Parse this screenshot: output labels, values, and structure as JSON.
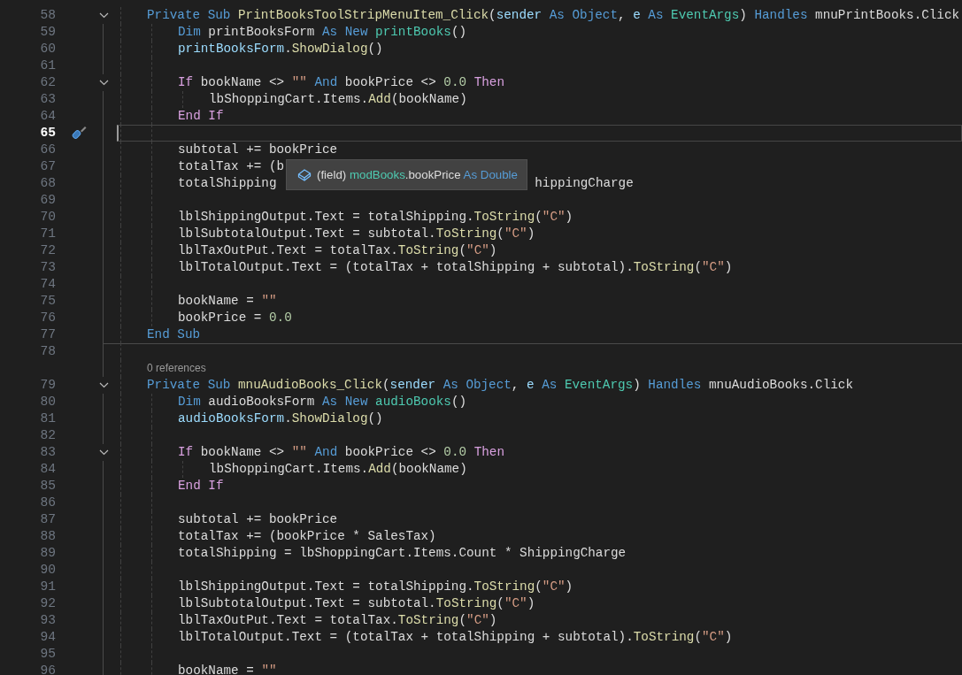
{
  "editor": {
    "lines": [
      {
        "number": "58",
        "expanded": true,
        "tokens": [
          {
            "text": "Private Sub ",
            "kind": "kw"
          },
          {
            "text": "PrintBooksToolStripMenuItem_Click",
            "kind": "method"
          },
          {
            "text": "(",
            "kind": "plain"
          },
          {
            "text": "sender",
            "kind": "param"
          },
          {
            "text": " As Object",
            "kind": "kw"
          },
          {
            "text": ", ",
            "kind": "plain"
          },
          {
            "text": "e",
            "kind": "param"
          },
          {
            "text": " As ",
            "kind": "kw"
          },
          {
            "text": "EventArgs",
            "kind": "type"
          },
          {
            "text": ") ",
            "kind": "plain"
          },
          {
            "text": "Handles",
            "kind": "kw"
          },
          {
            "text": " mnuPrintBooks.Click",
            "kind": "plain"
          }
        ],
        "children": [
          {
            "number": "59",
            "tokens": [
              {
                "text": "Dim ",
                "kind": "kw"
              },
              {
                "text": "printBooksForm",
                "kind": "plain"
              },
              {
                "text": " As New ",
                "kind": "kw"
              },
              {
                "text": "printBooks",
                "kind": "type"
              },
              {
                "text": "()",
                "kind": "plain"
              }
            ]
          },
          {
            "number": "60",
            "tokens": [
              {
                "text": "printBooksForm",
                "kind": "param"
              },
              {
                "text": ".",
                "kind": "plain"
              },
              {
                "text": "ShowDialog",
                "kind": "method"
              },
              {
                "text": "()",
                "kind": "plain"
              }
            ]
          },
          {
            "number": "61"
          },
          {
            "number": "62",
            "expanded": true,
            "tokens": [
              {
                "text": "If ",
                "kind": "ctl"
              },
              {
                "text": "bookName <> ",
                "kind": "plain"
              },
              {
                "text": "\"\"",
                "kind": "str"
              },
              {
                "text": " And ",
                "kind": "kw"
              },
              {
                "text": "bookPrice <> ",
                "kind": "plain"
              },
              {
                "text": "0.0",
                "kind": "num"
              },
              {
                "text": " Then",
                "kind": "ctl"
              }
            ],
            "children": [
              {
                "number": "63",
                "tokens": [
                  {
                    "text": "lbShoppingCart.Items.",
                    "kind": "plain"
                  },
                  {
                    "text": "Add",
                    "kind": "method"
                  },
                  {
                    "text": "(bookName)",
                    "kind": "plain"
                  }
                ]
              }
            ]
          },
          {
            "number": "64",
            "tokens": [
              {
                "text": "End If",
                "kind": "ctl"
              }
            ]
          },
          {
            "number": "65",
            "current": true
          },
          {
            "number": "66",
            "tokens": [
              {
                "text": "subtotal += bookPrice",
                "kind": "plain"
              }
            ]
          },
          {
            "number": "67",
            "tokens": [
              {
                "text": "totalTax += (b",
                "kind": "plain"
              }
            ]
          },
          {
            "number": "68",
            "tokens": [
              {
                "text": "totalShipping",
                "kind": "plain"
              },
              {
                "text": "hippingCharge",
                "kind": "plain",
                "after_tooltip": true
              }
            ]
          },
          {
            "number": "69"
          },
          {
            "number": "70",
            "tokens": [
              {
                "text": "lblShippingOutput.Text = totalShipping.",
                "kind": "plain"
              },
              {
                "text": "ToString",
                "kind": "method"
              },
              {
                "text": "(",
                "kind": "plain"
              },
              {
                "text": "\"C\"",
                "kind": "str"
              },
              {
                "text": ")",
                "kind": "plain"
              }
            ]
          },
          {
            "number": "71",
            "tokens": [
              {
                "text": "lblSubtotalOutput.Text = subtotal.",
                "kind": "plain"
              },
              {
                "text": "ToString",
                "kind": "method"
              },
              {
                "text": "(",
                "kind": "plain"
              },
              {
                "text": "\"C\"",
                "kind": "str"
              },
              {
                "text": ")",
                "kind": "plain"
              }
            ]
          },
          {
            "number": "72",
            "tokens": [
              {
                "text": "lblTaxOutPut.Text = totalTax.",
                "kind": "plain"
              },
              {
                "text": "ToString",
                "kind": "method"
              },
              {
                "text": "(",
                "kind": "plain"
              },
              {
                "text": "\"C\"",
                "kind": "str"
              },
              {
                "text": ")",
                "kind": "plain"
              }
            ]
          },
          {
            "number": "73",
            "tokens": [
              {
                "text": "lblTotalOutput.Text = (totalTax + totalShipping + subtotal).",
                "kind": "plain"
              },
              {
                "text": "ToString",
                "kind": "method"
              },
              {
                "text": "(",
                "kind": "plain"
              },
              {
                "text": "\"C\"",
                "kind": "str"
              },
              {
                "text": ")",
                "kind": "plain"
              }
            ]
          },
          {
            "number": "74"
          },
          {
            "number": "75",
            "tokens": [
              {
                "text": "bookName = ",
                "kind": "plain"
              },
              {
                "text": "\"\"",
                "kind": "str"
              }
            ]
          },
          {
            "number": "76",
            "tokens": [
              {
                "text": "bookPrice = ",
                "kind": "plain"
              },
              {
                "text": "0.0",
                "kind": "num"
              }
            ]
          }
        ]
      },
      {
        "number": "77",
        "separator_below": true,
        "tokens": [
          {
            "text": "End Sub",
            "kind": "kw"
          }
        ]
      },
      {
        "number": "78"
      },
      {
        "number": "79",
        "expanded": true,
        "codelens": "0 references",
        "tokens": [
          {
            "text": "Private Sub ",
            "kind": "kw"
          },
          {
            "text": "mnuAudioBooks_Click",
            "kind": "method"
          },
          {
            "text": "(",
            "kind": "plain"
          },
          {
            "text": "sender",
            "kind": "param"
          },
          {
            "text": " As Object",
            "kind": "kw"
          },
          {
            "text": ", ",
            "kind": "plain"
          },
          {
            "text": "e",
            "kind": "param"
          },
          {
            "text": " As ",
            "kind": "kw"
          },
          {
            "text": "EventArgs",
            "kind": "type"
          },
          {
            "text": ") ",
            "kind": "plain"
          },
          {
            "text": "Handles",
            "kind": "kw"
          },
          {
            "text": " mnuAudioBooks.Click",
            "kind": "plain"
          }
        ],
        "children": [
          {
            "number": "80",
            "tokens": [
              {
                "text": "Dim ",
                "kind": "kw"
              },
              {
                "text": "audioBooksForm",
                "kind": "plain"
              },
              {
                "text": " As New ",
                "kind": "kw"
              },
              {
                "text": "audioBooks",
                "kind": "type"
              },
              {
                "text": "()",
                "kind": "plain"
              }
            ]
          },
          {
            "number": "81",
            "tokens": [
              {
                "text": "audioBooksForm",
                "kind": "param"
              },
              {
                "text": ".",
                "kind": "plain"
              },
              {
                "text": "ShowDialog",
                "kind": "method"
              },
              {
                "text": "()",
                "kind": "plain"
              }
            ]
          },
          {
            "number": "82"
          },
          {
            "number": "83",
            "expanded": true,
            "tokens": [
              {
                "text": "If ",
                "kind": "ctl"
              },
              {
                "text": "bookName <> ",
                "kind": "plain"
              },
              {
                "text": "\"\"",
                "kind": "str"
              },
              {
                "text": " And ",
                "kind": "kw"
              },
              {
                "text": "bookPrice <> ",
                "kind": "plain"
              },
              {
                "text": "0.0",
                "kind": "num"
              },
              {
                "text": " Then",
                "kind": "ctl"
              }
            ],
            "children": [
              {
                "number": "84",
                "tokens": [
                  {
                    "text": "lbShoppingCart.Items.",
                    "kind": "plain"
                  },
                  {
                    "text": "Add",
                    "kind": "method"
                  },
                  {
                    "text": "(bookName)",
                    "kind": "plain"
                  }
                ]
              }
            ]
          },
          {
            "number": "85",
            "tokens": [
              {
                "text": "End If",
                "kind": "ctl"
              }
            ]
          },
          {
            "number": "86"
          },
          {
            "number": "87",
            "tokens": [
              {
                "text": "subtotal += bookPrice",
                "kind": "plain"
              }
            ]
          },
          {
            "number": "88",
            "tokens": [
              {
                "text": "totalTax += (bookPrice * SalesTax)",
                "kind": "plain"
              }
            ]
          },
          {
            "number": "89",
            "tokens": [
              {
                "text": "totalShipping = lbShoppingCart.Items.Count * ShippingCharge",
                "kind": "plain"
              }
            ]
          },
          {
            "number": "90"
          },
          {
            "number": "91",
            "tokens": [
              {
                "text": "lblShippingOutput.Text = totalShipping.",
                "kind": "plain"
              },
              {
                "text": "ToString",
                "kind": "method"
              },
              {
                "text": "(",
                "kind": "plain"
              },
              {
                "text": "\"C\"",
                "kind": "str"
              },
              {
                "text": ")",
                "kind": "plain"
              }
            ]
          },
          {
            "number": "92",
            "tokens": [
              {
                "text": "lblSubtotalOutput.Text = subtotal.",
                "kind": "plain"
              },
              {
                "text": "ToString",
                "kind": "method"
              },
              {
                "text": "(",
                "kind": "plain"
              },
              {
                "text": "\"C\"",
                "kind": "str"
              },
              {
                "text": ")",
                "kind": "plain"
              }
            ]
          },
          {
            "number": "93",
            "tokens": [
              {
                "text": "lblTaxOutPut.Text = totalTax.",
                "kind": "plain"
              },
              {
                "text": "ToString",
                "kind": "method"
              },
              {
                "text": "(",
                "kind": "plain"
              },
              {
                "text": "\"C\"",
                "kind": "str"
              },
              {
                "text": ")",
                "kind": "plain"
              }
            ]
          },
          {
            "number": "94",
            "tokens": [
              {
                "text": "lblTotalOutput.Text = (totalTax + totalShipping + subtotal).",
                "kind": "plain"
              },
              {
                "text": "ToString",
                "kind": "method"
              },
              {
                "text": "(",
                "kind": "plain"
              },
              {
                "text": "\"C\"",
                "kind": "str"
              },
              {
                "text": ")",
                "kind": "plain"
              }
            ]
          },
          {
            "number": "95"
          },
          {
            "number": "96",
            "tokens": [
              {
                "text": "bookName = ",
                "kind": "plain"
              },
              {
                "text": "\"\"",
                "kind": "str"
              }
            ]
          }
        ]
      }
    ],
    "tooltip": {
      "tokens": [
        {
          "text": "(field) ",
          "kind": "plain"
        },
        {
          "text": "modBooks",
          "kind": "type"
        },
        {
          "text": ".bookPrice ",
          "kind": "plain"
        },
        {
          "text": "As Double",
          "kind": "kw"
        }
      ]
    }
  }
}
